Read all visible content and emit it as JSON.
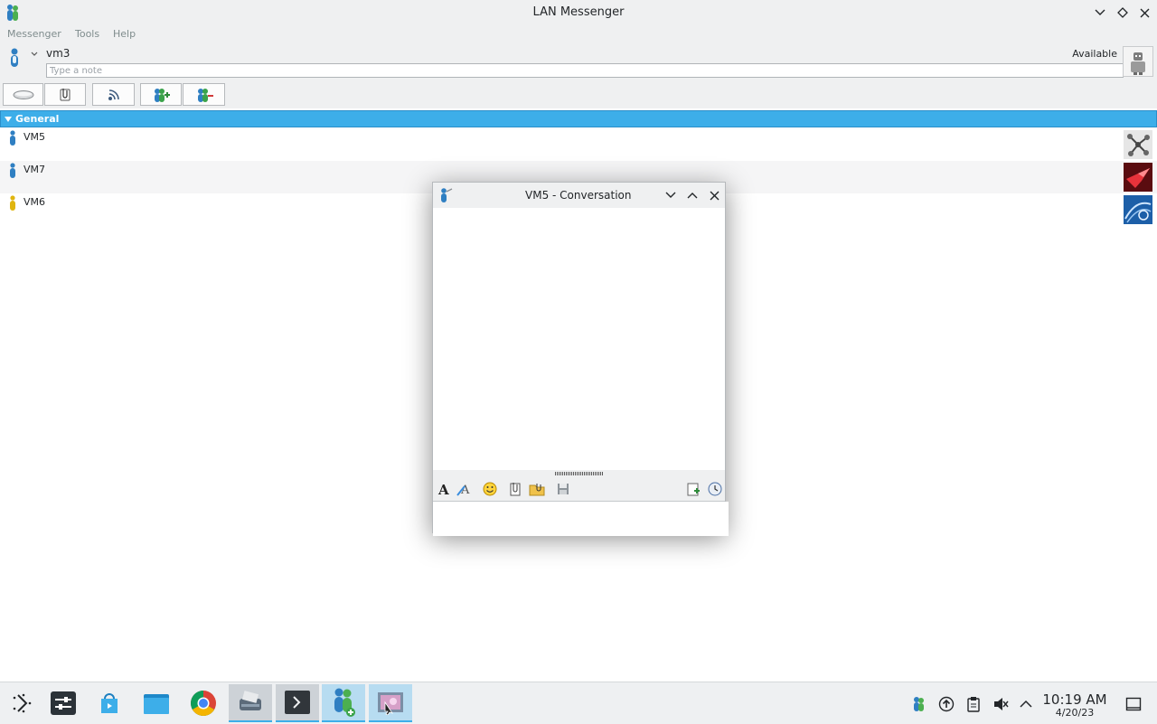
{
  "window": {
    "title": "LAN Messenger"
  },
  "menubar": {
    "items": [
      "Messenger",
      "Tools",
      "Help"
    ]
  },
  "user": {
    "name": "vm3",
    "status": "Available",
    "note_placeholder": "Type a note",
    "note_value": ""
  },
  "toolbar": {
    "buttons": [
      "chat-icon",
      "file-transfer-icon",
      "broadcast-icon",
      "add-contact-icon",
      "remove-contact-icon"
    ]
  },
  "contacts": {
    "group": "General",
    "items": [
      {
        "name": "VM5",
        "status": "online",
        "status_color": "#3daee9"
      },
      {
        "name": "VM7",
        "status": "online",
        "status_color": "#3daee9"
      },
      {
        "name": "VM6",
        "status": "away",
        "status_color": "#f1c40f"
      }
    ]
  },
  "conversation": {
    "title": "VM5 - Conversation",
    "tools": [
      "font-icon",
      "font-color-icon",
      "emoticon-icon",
      "send-file-icon",
      "send-folder-icon",
      "save-icon",
      "add-participant-icon",
      "history-icon"
    ],
    "input_value": ""
  },
  "taskbar": {
    "apps": [
      "application-launcher",
      "system-settings",
      "app-store",
      "file-manager",
      "chrome",
      "scanner",
      "terminal",
      "lan-messenger",
      "image-viewer"
    ],
    "clock_time": "10:19 AM",
    "clock_date": "4/20/23"
  },
  "colors": {
    "accent": "#3daee9",
    "away": "#f1c40f",
    "chrome_bg": "#eff0f1"
  }
}
